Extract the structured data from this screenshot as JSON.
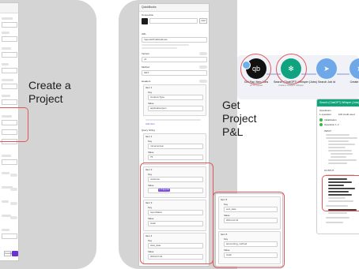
{
  "captions": {
    "create_project": "Create a Project",
    "get_pl": "Get Project P&L"
  },
  "left_form": {
    "cancel_label": "Cancel",
    "save_color": "#6d2fd6"
  },
  "config_panel": {
    "title": "QuickBooks",
    "connection_label": "Connection",
    "add_label": "Add",
    "url_label": "URL",
    "url_value": "/reports/ProfitAndLoss",
    "version_label": "Version",
    "version_value": "v3",
    "method_label": "Method",
    "method_value": "GET",
    "headers_label": "Headers",
    "items": [
      {
        "title": "Item 1",
        "key": "Content-Type",
        "value": "application/json"
      },
      {
        "title": "Item 1",
        "key": "minorversion",
        "value": "75"
      },
      {
        "title": "Item 2",
        "key": "customer",
        "value": ""
      },
      {
        "title": "Item 3",
        "key": "reportbasis",
        "value": "Cash"
      },
      {
        "title": "Item 4",
        "key": "start_date",
        "value": "2024-07-01"
      }
    ],
    "add_item_label": "Add item",
    "query_string_label": "Query String",
    "key_label": "Key",
    "value_label": "Value",
    "tag_label": "1. Project ID"
  },
  "item_panel": {
    "items": [
      {
        "title": "Item 5",
        "key": "end_date",
        "value": "2024-12-31"
      },
      {
        "title": "Item 6",
        "key": "accounting_method",
        "value": "Cash"
      }
    ]
  },
  "flow": {
    "nodes": [
      {
        "label": "Get Pay. Item Jobs",
        "sub": "HTTP request",
        "badge": "1",
        "color": "#111111"
      },
      {
        "label": "Search (ChatGPT) Whisper (Jobs)",
        "sub": "Create a ChatGPT Whisper",
        "badge": "2",
        "color": "#10a37f"
      },
      {
        "label": "Search Job id",
        "sub": "",
        "badge": "",
        "color": "#6fa8e8"
      },
      {
        "label": "Create",
        "sub": "",
        "badge": "",
        "color": "#6fa8e8"
      }
    ]
  },
  "output_panel": {
    "title": "Search (ChatGPT) Whisper (Jobs) output",
    "operations_label": "Operations",
    "op_count": "1 operation",
    "credits": "100 credit used",
    "init_label": "Initialization",
    "operation_label": "Operation 1 ✔",
    "input_label": "INPUT",
    "output_label": "OUTPUT"
  },
  "colors": {
    "highlight": "#e05656",
    "card_bg": "#d4d4d4",
    "chatgpt_green": "#10a37f",
    "accent_purple": "#7c4ae0"
  }
}
